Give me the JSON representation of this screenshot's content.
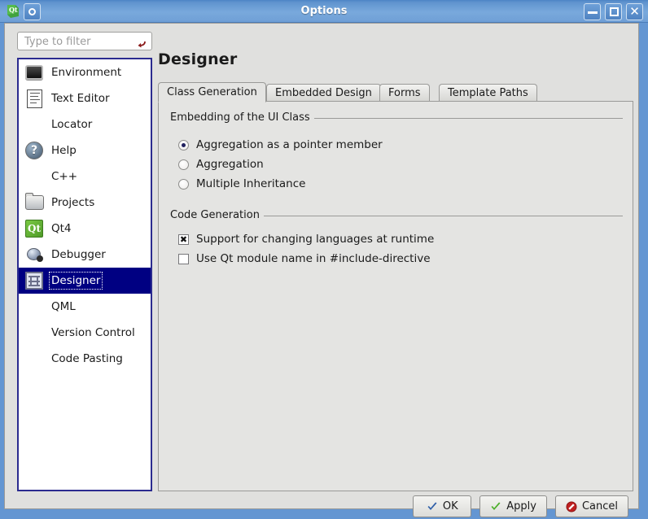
{
  "window": {
    "title": "Options",
    "app_icon": "qt-logo-icon",
    "menu_icon": "window-menu-icon",
    "controls": [
      {
        "name": "minimize-button",
        "glyph": "_"
      },
      {
        "name": "maximize-button",
        "glyph": "□"
      },
      {
        "name": "close-button",
        "glyph": "✕"
      }
    ]
  },
  "search": {
    "placeholder": "Type to filter",
    "value": "",
    "clear_icon": "clear-filter-icon"
  },
  "page": {
    "title": "Designer"
  },
  "sidebar": {
    "items": [
      {
        "label": "Environment",
        "icon": "monitor-icon",
        "selected": false
      },
      {
        "label": "Text Editor",
        "icon": "document-icon",
        "selected": false
      },
      {
        "label": "Locator",
        "icon": "none",
        "selected": false
      },
      {
        "label": "Help",
        "icon": "help-icon",
        "selected": false
      },
      {
        "label": "C++",
        "icon": "none",
        "selected": false
      },
      {
        "label": "Projects",
        "icon": "folder-icon",
        "selected": false
      },
      {
        "label": "Qt4",
        "icon": "qt-icon",
        "selected": false
      },
      {
        "label": "Debugger",
        "icon": "bug-icon",
        "selected": false
      },
      {
        "label": "Designer",
        "icon": "designer-icon",
        "selected": true
      },
      {
        "label": "QML",
        "icon": "none",
        "selected": false
      },
      {
        "label": "Version Control",
        "icon": "none",
        "selected": false
      },
      {
        "label": "Code Pasting",
        "icon": "none",
        "selected": false
      }
    ]
  },
  "tabs": [
    {
      "label": "Class Generation",
      "active": true
    },
    {
      "label": "Embedded Design",
      "active": false
    },
    {
      "label": "Forms",
      "active": false
    },
    {
      "label": "Template Paths",
      "active": false
    }
  ],
  "groups": [
    {
      "title": "Embedding of the UI Class",
      "type": "radio",
      "options": [
        {
          "label": "Aggregation as a pointer member",
          "checked": true
        },
        {
          "label": "Aggregation",
          "checked": false
        },
        {
          "label": "Multiple Inheritance",
          "checked": false
        }
      ]
    },
    {
      "title": "Code Generation",
      "type": "checkbox",
      "options": [
        {
          "label": "Support for changing languages at runtime",
          "checked": true
        },
        {
          "label": "Use Qt module name in #include-directive",
          "checked": false
        }
      ]
    }
  ],
  "buttons": [
    {
      "label": "OK",
      "icon": "check-blue-icon",
      "color": "#2f5fa8"
    },
    {
      "label": "Apply",
      "icon": "check-green-icon",
      "color": "#3f9d2f"
    },
    {
      "label": "Cancel",
      "icon": "cancel-red-icon",
      "color": "#c02020"
    }
  ],
  "colors": {
    "titlebar": "#5f93ce",
    "selection": "#000082",
    "window_bg": "#e0e0de",
    "panel_bg": "#e4e4e2",
    "focus_border": "#2b2b8f"
  }
}
